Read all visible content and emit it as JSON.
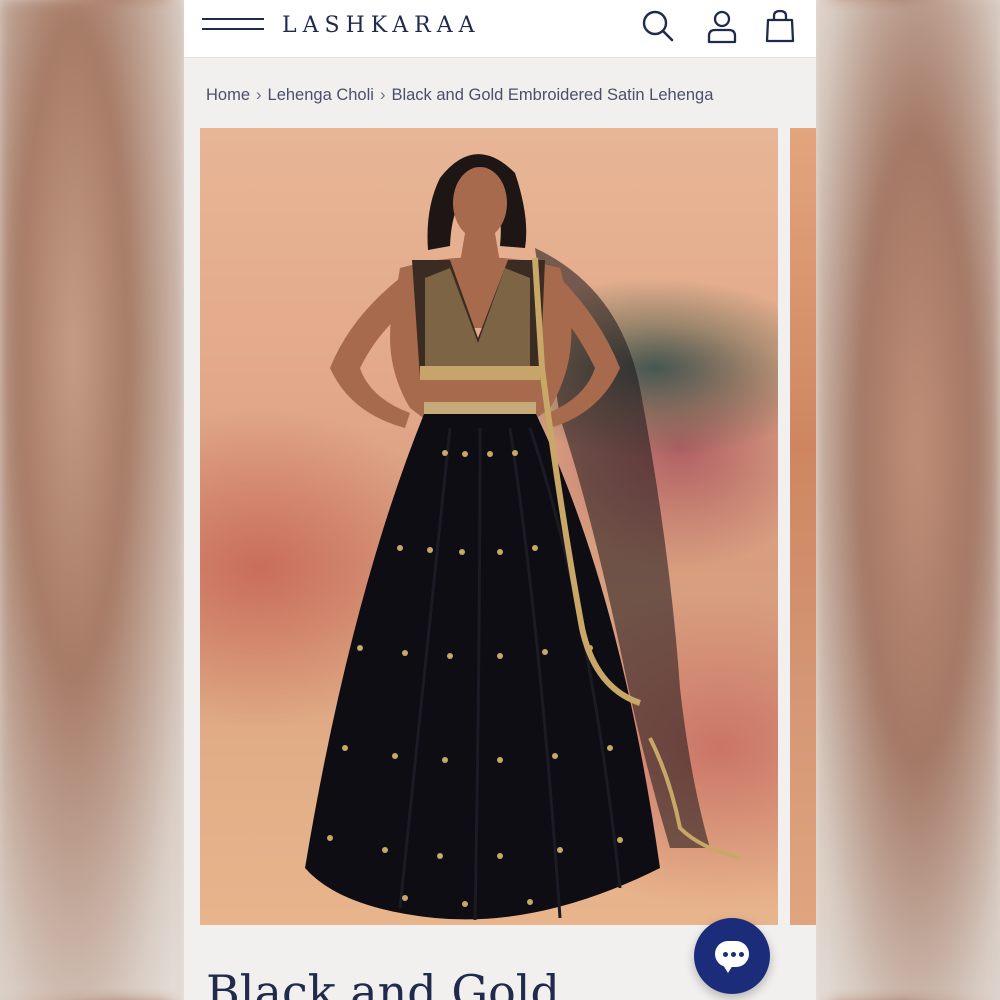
{
  "header": {
    "brand": "LASHKARAA",
    "icons": [
      "menu-icon",
      "search-icon",
      "account-icon",
      "shopping-bag-icon"
    ],
    "accent_color": "#1f2a4d"
  },
  "breadcrumb": {
    "items": [
      "Home",
      "Lehenga Choli",
      "Black and Gold Embroidered Satin Lehenga"
    ],
    "separator": "›"
  },
  "product": {
    "title": "Black and Gold"
  },
  "chat": {
    "icon": "chat-bubble-icon",
    "color": "#1b2d7a"
  }
}
